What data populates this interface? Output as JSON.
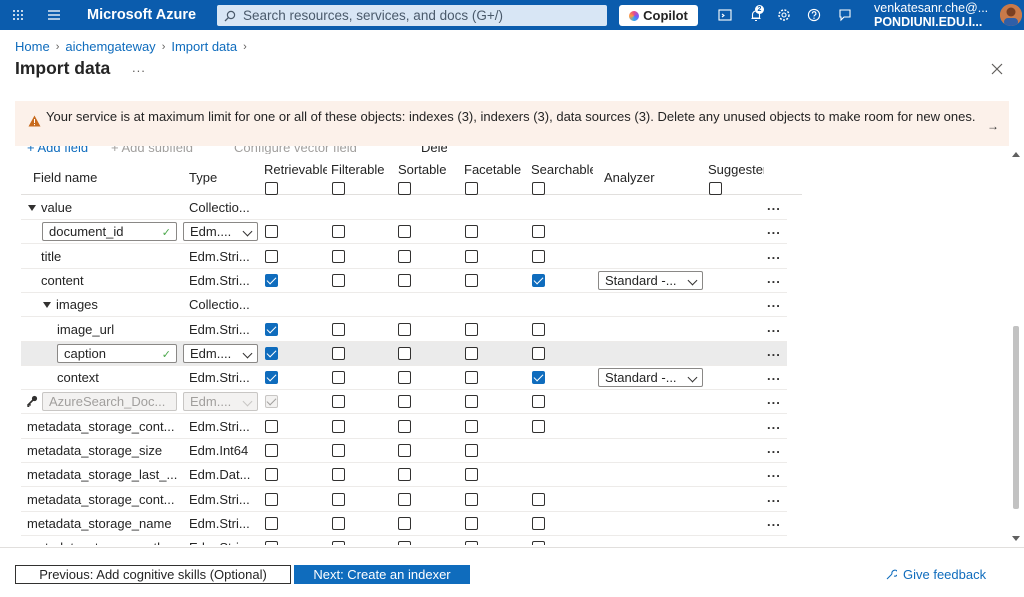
{
  "topbar": {
    "brand": "Microsoft Azure",
    "search_placeholder": "Search resources, services, and docs (G+/)",
    "copilot_label": "Copilot",
    "notification_count": "2",
    "user_email": "venkatesanr.che@...",
    "user_org": "PONDIUNI.EDU.I...",
    "accent_color": "#0b5cad"
  },
  "breadcrumb": {
    "home": "Home",
    "service": "aichemgateway",
    "current": "Import data"
  },
  "page": {
    "title": "Import data",
    "more": "...",
    "close_icon": "close-icon"
  },
  "banner": {
    "text": "Your service is at maximum limit for one or all of these objects: indexes (3), indexers (3), data sources (3). Delete any unused objects to make room for new ones.",
    "arrow": "→"
  },
  "toolbar": {
    "add_field": "+ Add field",
    "add_subfield": "+ Add subfield",
    "configure_vector": "Configure vector field",
    "delete": "Delete"
  },
  "grid": {
    "headers": {
      "field_name": "Field name",
      "type": "Type",
      "retrievable": "Retrievable",
      "filterable": "Filterable",
      "sortable": "Sortable",
      "facetable": "Facetable",
      "searchable": "Searchable",
      "analyzer": "Analyzer",
      "suggester": "Suggester"
    },
    "rows": [
      {
        "name": "value",
        "type": "Collectio..."
      },
      {
        "name": "document_id",
        "type": "Edm...."
      },
      {
        "name": "title",
        "type": "Edm.Stri..."
      },
      {
        "name": "content",
        "type": "Edm.Stri...",
        "analyzer": "Standard -..."
      },
      {
        "name": "images",
        "type": "Collectio..."
      },
      {
        "name": "image_url",
        "type": "Edm.Stri..."
      },
      {
        "name": "caption",
        "type": "Edm...."
      },
      {
        "name": "context",
        "type": "Edm.Stri...",
        "analyzer": "Standard -..."
      },
      {
        "name": "AzureSearch_Doc...",
        "type": "Edm...."
      },
      {
        "name": "metadata_storage_cont...",
        "type": "Edm.Stri..."
      },
      {
        "name": "metadata_storage_size",
        "type": "Edm.Int64"
      },
      {
        "name": "metadata_storage_last_...",
        "type": "Edm.Dat..."
      },
      {
        "name": "metadata_storage_cont...",
        "type": "Edm.Stri..."
      },
      {
        "name": "metadata_storage_name",
        "type": "Edm.Stri..."
      },
      {
        "name": "metadata_storage_path",
        "type": "Edm.Stri..."
      }
    ],
    "row_more": "..."
  },
  "footer": {
    "previous": "Previous: Add cognitive skills (Optional)",
    "next": "Next: Create an indexer",
    "feedback": "Give feedback"
  }
}
